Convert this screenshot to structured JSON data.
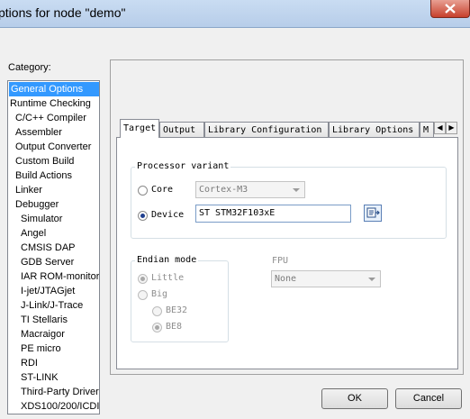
{
  "window": {
    "title": "ptions for node \"demo\""
  },
  "category": {
    "label": "Category:",
    "items": [
      {
        "label": "General Options",
        "selected": true,
        "indent": 0
      },
      {
        "label": "Runtime Checking",
        "indent": 0
      },
      {
        "label": "C/C++ Compiler",
        "indent": 1
      },
      {
        "label": "Assembler",
        "indent": 1
      },
      {
        "label": "Output Converter",
        "indent": 1
      },
      {
        "label": "Custom Build",
        "indent": 1
      },
      {
        "label": "Build Actions",
        "indent": 1
      },
      {
        "label": "Linker",
        "indent": 1
      },
      {
        "label": "Debugger",
        "indent": 1
      },
      {
        "label": "Simulator",
        "indent": 2
      },
      {
        "label": "Angel",
        "indent": 2
      },
      {
        "label": "CMSIS DAP",
        "indent": 2
      },
      {
        "label": "GDB Server",
        "indent": 2
      },
      {
        "label": "IAR ROM-monitor",
        "indent": 2
      },
      {
        "label": "I-jet/JTAGjet",
        "indent": 2
      },
      {
        "label": "J-Link/J-Trace",
        "indent": 2
      },
      {
        "label": "TI Stellaris",
        "indent": 2
      },
      {
        "label": "Macraigor",
        "indent": 2
      },
      {
        "label": "PE micro",
        "indent": 2
      },
      {
        "label": "RDI",
        "indent": 2
      },
      {
        "label": "ST-LINK",
        "indent": 2
      },
      {
        "label": "Third-Party Driver",
        "indent": 2
      },
      {
        "label": "XDS100/200/ICDI",
        "indent": 2
      }
    ]
  },
  "tabs": [
    "Target",
    "Output",
    "Library Configuration",
    "Library Options",
    "M"
  ],
  "processor": {
    "legend": "Processor variant",
    "core_label": "Core",
    "core_value": "Cortex-M3",
    "device_label": "Device",
    "device_value": "ST STM32F103xE"
  },
  "endian": {
    "legend": "Endian mode",
    "little": "Little",
    "big": "Big",
    "be32": "BE32",
    "be8": "BE8"
  },
  "fpu": {
    "label": "FPU",
    "value": "None"
  },
  "buttons": {
    "ok": "OK",
    "cancel": "Cancel"
  }
}
